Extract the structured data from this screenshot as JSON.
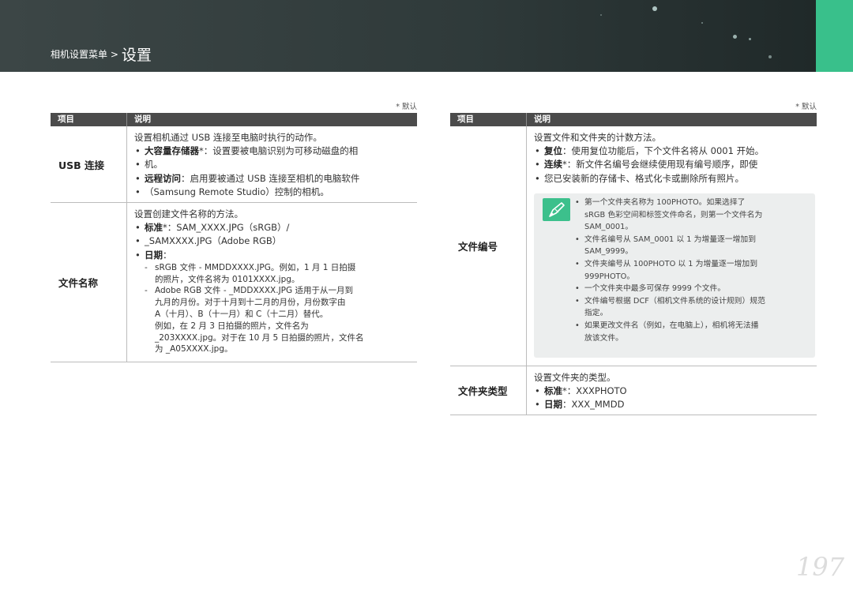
{
  "header": {
    "breadcrumb_path": "相机设置菜单 >",
    "current_section": "设置"
  },
  "default_note": "* 默认",
  "table_headers": {
    "item": "项目",
    "description": "说明"
  },
  "left_table": {
    "usb": {
      "item": "USB 连接",
      "intro": "设置相机通过 USB 连接至电脑时执行的动作。",
      "storage_key": "大容量存储器",
      "storage_text": "*：设置要被电脑识别为可移动磁盘的相",
      "storage_text_cont": "机。",
      "remote_key": "远程访问",
      "remote_text": "：启用要被通过 USB 连接至相机的电脑软件",
      "remote_text_cont": "（Samsung Remote Studio）控制的相机。"
    },
    "file_name": {
      "item": "文件名称",
      "intro": "设置创建文件名称的方法。",
      "standard_key": "标准",
      "standard_text": "*：SAM_XXXX.JPG（sRGB）/",
      "standard_text_cont": "_SAMXXXX.JPG（Adobe RGB）",
      "date_key": "日期",
      "date_text": "：",
      "srgb_line1": "sRGB 文件 - MMDDXXXX.JPG。例如，1 月 1 日拍摄",
      "srgb_line2": "的照片，文件名将为 0101XXXX.jpg。",
      "adobe_line1": "Adobe RGB 文件 - _MDDXXXX.JPG 适用于从一月到",
      "adobe_line2": "九月的月份。对于十月到十二月的月份，月份数字由",
      "adobe_line3": "A（十月）、B（十一月）和 C（十二月）替代。",
      "adobe_line4": "例如，在 2 月 3 日拍摄的照片，文件名为",
      "adobe_line5": "_203XXXX.jpg。对于在 10 月 5 日拍摄的照片，文件名",
      "adobe_line6": "为 _A05XXXX.jpg。"
    }
  },
  "right_table": {
    "file_number": {
      "item": "文件编号",
      "intro": "设置文件和文件夹的计数方法。",
      "reset_key": "复位",
      "reset_text": "：使用复位功能后，下个文件名将从 0001 开始。",
      "series_key": "连续",
      "series_text": "*：新文件名编号会继续使用现有编号顺序，即使",
      "series_text_cont": "您已安装新的存储卡、格式化卡或删除所有照片。",
      "notes": {
        "n1_l1": "第一个文件夹名称为 100PHOTO。如果选择了",
        "n1_l2": "sRGB 色彩空间和标签文件命名，则第一个文件名为",
        "n1_l3": "SAM_0001。",
        "n2_l1": "文件名编号从 SAM_0001 以 1 为增量逐一增加到",
        "n2_l2": "SAM_9999。",
        "n3_l1": "文件夹编号从 100PHOTO 以 1 为增量逐一增加到",
        "n3_l2": "999PHOTO。",
        "n4_l1": "一个文件夹中最多可保存 9999 个文件。",
        "n5_l1": "文件编号根据 DCF（相机文件系统的设计规则）规范",
        "n5_l2": "指定。",
        "n6_l1": "如果更改文件名（例如，在电脑上），相机将无法播",
        "n6_l2": "放该文件。"
      }
    },
    "folder_type": {
      "item": "文件夹类型",
      "intro": "设置文件夹的类型。",
      "standard_key": "标准",
      "standard_text": "*：XXXPHOTO",
      "date_key": "日期",
      "date_text": "：XXX_MMDD"
    }
  },
  "page_number": "197",
  "colors": {
    "banner": "#2f3a3a",
    "accent_green": "#39c08b",
    "table_header": "#4b4b4b",
    "note_bg": "#eceeee"
  }
}
